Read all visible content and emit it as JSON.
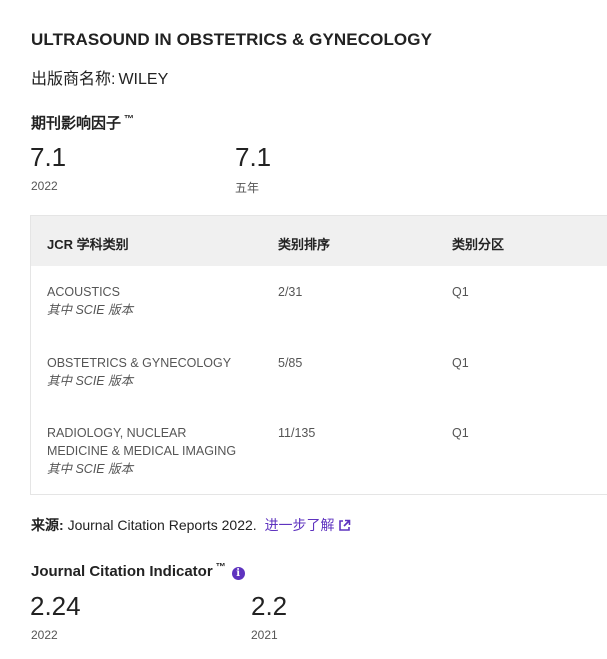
{
  "journal": {
    "title": "ULTRASOUND IN OBSTETRICS & GYNECOLOGY",
    "publisher_label": "出版商名称:",
    "publisher_name": "WILEY"
  },
  "impact_factor": {
    "title": "期刊影响因子",
    "tm": "™",
    "current_value": "7.1",
    "current_year": "2022",
    "five_year_value": "7.1",
    "five_year_label": "五年"
  },
  "jcr_table": {
    "headers": [
      "JCR 学科类别",
      "类别排序",
      "类别分区"
    ],
    "rows": [
      {
        "category": "ACOUSTICS",
        "edition": "其中 SCIE 版本",
        "rank": "2/31",
        "quartile": "Q1"
      },
      {
        "category": "OBSTETRICS & GYNECOLOGY",
        "edition": "其中 SCIE 版本",
        "rank": "5/85",
        "quartile": "Q1"
      },
      {
        "category": "RADIOLOGY, NUCLEAR MEDICINE & MEDICAL IMAGING",
        "edition": "其中 SCIE 版本",
        "rank": "11/135",
        "quartile": "Q1"
      }
    ]
  },
  "source": {
    "label": "来源:",
    "text": "Journal Citation Reports  2022.",
    "link_text": "进一步了解",
    "link_icon": "external-link-icon"
  },
  "jci": {
    "title": "Journal Citation Indicator",
    "tm": "™",
    "info_icon": "info-icon",
    "values": [
      {
        "value": "2.24",
        "year": "2022"
      },
      {
        "value": "2.2",
        "year": "2021"
      }
    ]
  },
  "colors": {
    "accent": "#5e33bf",
    "table_header_bg": "#f0f0f0",
    "text": "#222222",
    "muted": "#555555"
  }
}
